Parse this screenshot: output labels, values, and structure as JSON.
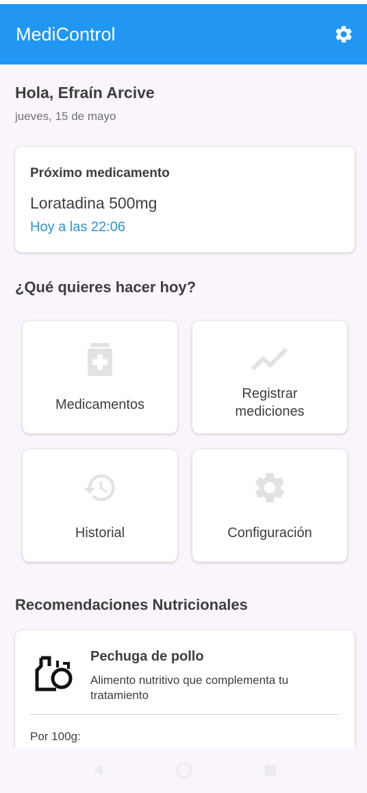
{
  "app_bar": {
    "title": "MediControl",
    "settings_icon": "gear-icon",
    "background_color": "#2196f3"
  },
  "home": {
    "greeting": "Hola, Efraín Arcive",
    "date": "jueves, 15 de mayo"
  },
  "next_medication": {
    "heading": "Próximo medicamento",
    "name": "Loratadina 500mg",
    "time": "Hoy a las 22:06",
    "time_color": "#2a93d6"
  },
  "actions": {
    "title": "¿Qué quieres hacer hoy?",
    "tiles": [
      {
        "label": "Medicamentos",
        "icon": "medicine-bottle-icon"
      },
      {
        "label_line1": "Registrar",
        "label_line2": "mediciones",
        "icon": "trending-line-icon"
      },
      {
        "label": "Historial",
        "icon": "history-icon"
      },
      {
        "label": "Configuración",
        "icon": "gear-icon"
      }
    ]
  },
  "nutrition": {
    "title": "Recomendaciones Nutricionales",
    "food": {
      "name": "Pechuga de pollo",
      "description": "Alimento nutritivo que complementa tu tratamiento",
      "portion_label": "Por 100g:",
      "icon": "food-icon"
    }
  },
  "system_nav": {
    "back_icon": "back-triangle-icon",
    "home_icon": "home-circle-icon",
    "recents_icon": "recents-square-icon"
  }
}
